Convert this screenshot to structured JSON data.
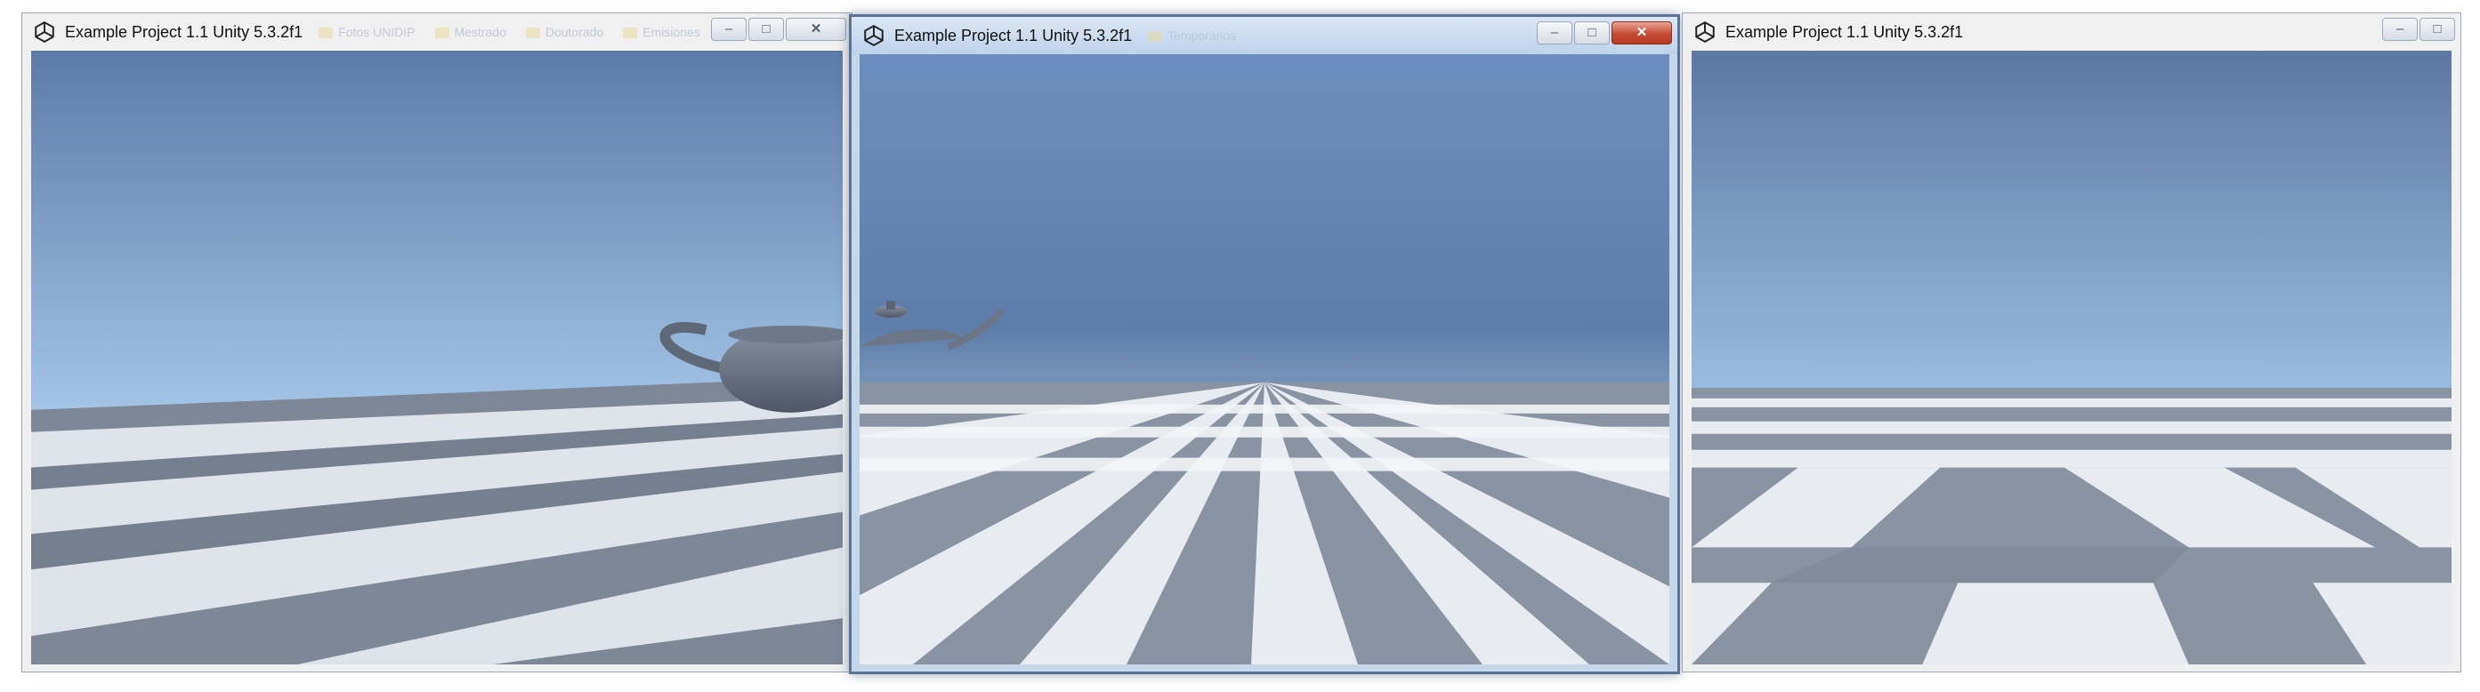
{
  "windows": [
    {
      "title": "Example Project 1.1 Unity 5.3.2f1",
      "ghost_items": [
        "Fotos UNIDIP",
        "Mestrado",
        "Doutorado",
        "Emisiones"
      ],
      "controls": {
        "minimize": "–",
        "maximize": "□",
        "close": "✕"
      },
      "active": false
    },
    {
      "title": "Example Project 1.1 Unity 5.3.2f1",
      "ghost_items": [
        "Temporários"
      ],
      "controls": {
        "minimize": "–",
        "maximize": "□",
        "close": "✕"
      },
      "active": true
    },
    {
      "title": "Example Project 1.1 Unity 5.3.2f1",
      "ghost_items": [],
      "controls": {
        "minimize": "–",
        "maximize": "□"
      },
      "active": false
    }
  ],
  "colors": {
    "sky_top": "#5e7aa8",
    "sky_horizon": "#dbe9f6",
    "tile_light": "#e6ebef",
    "tile_dark": "#8a93a2",
    "teapot": "#6b7483",
    "close_red": "#c54b34"
  },
  "icons": {
    "app": "unity-icon"
  }
}
